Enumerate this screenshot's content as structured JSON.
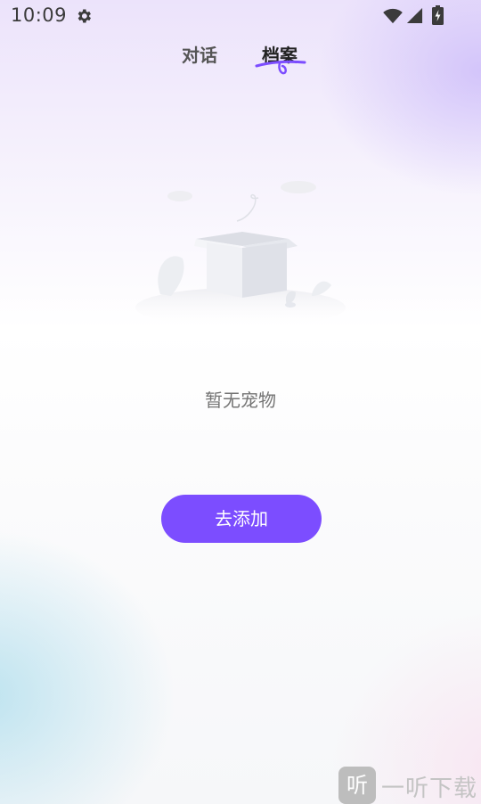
{
  "status_bar": {
    "time": "10:09",
    "icons": [
      "gear-icon",
      "wifi-icon",
      "signal-icon",
      "battery-charging-icon"
    ]
  },
  "tabs": [
    {
      "label": "对话",
      "active": false
    },
    {
      "label": "档案",
      "active": true
    }
  ],
  "colors": {
    "accent": "#7c4dff",
    "active_tab_text": "#222222",
    "inactive_tab_text": "#555555",
    "empty_text": "#757575"
  },
  "empty_state": {
    "illustration": "open-empty-box-icon",
    "message": "暂无宠物",
    "button_label": "去添加"
  },
  "watermark": {
    "logo_glyph": "听",
    "text": "一听下载"
  }
}
